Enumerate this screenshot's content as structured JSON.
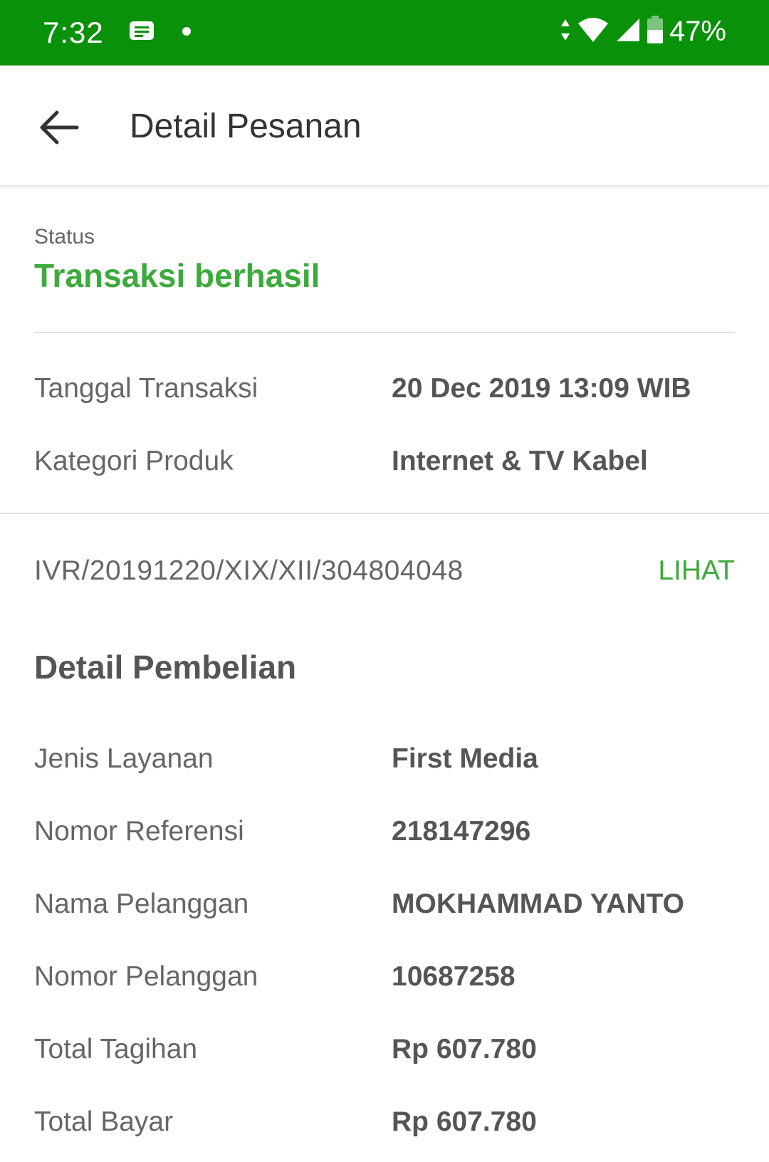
{
  "status_bar": {
    "time": "7:32",
    "battery_percent": "47%",
    "icons": [
      "message-icon",
      "notification-dot-icon",
      "data-arrows-icon",
      "wifi-icon",
      "cell-signal-icon",
      "battery-icon"
    ]
  },
  "header": {
    "title": "Detail Pesanan",
    "back_icon": "arrow-left-icon"
  },
  "status": {
    "label": "Status",
    "value": "Transaksi berhasil"
  },
  "transaction": {
    "date_label": "Tanggal Transaksi",
    "date_value": "20 Dec 2019 13:09  WIB",
    "category_label": "Kategori Produk",
    "category_value": "Internet & TV Kabel"
  },
  "invoice": {
    "number": "IVR/20191220/XIX/XII/304804048",
    "action_label": "LIHAT"
  },
  "purchase_details": {
    "title": "Detail Pembelian",
    "rows": [
      {
        "label": "Jenis Layanan",
        "value": "First Media"
      },
      {
        "label": "Nomor Referensi",
        "value": "218147296"
      },
      {
        "label": "Nama Pelanggan",
        "value": "MOKHAMMAD YANTO"
      },
      {
        "label": "Nomor Pelanggan",
        "value": "10687258"
      },
      {
        "label": "Total Tagihan",
        "value": "Rp 607.780"
      },
      {
        "label": "Total Bayar",
        "value": "Rp 607.780"
      }
    ]
  },
  "colors": {
    "status_bar_green": "#0a910a",
    "accent_green": "#3daa3d"
  }
}
